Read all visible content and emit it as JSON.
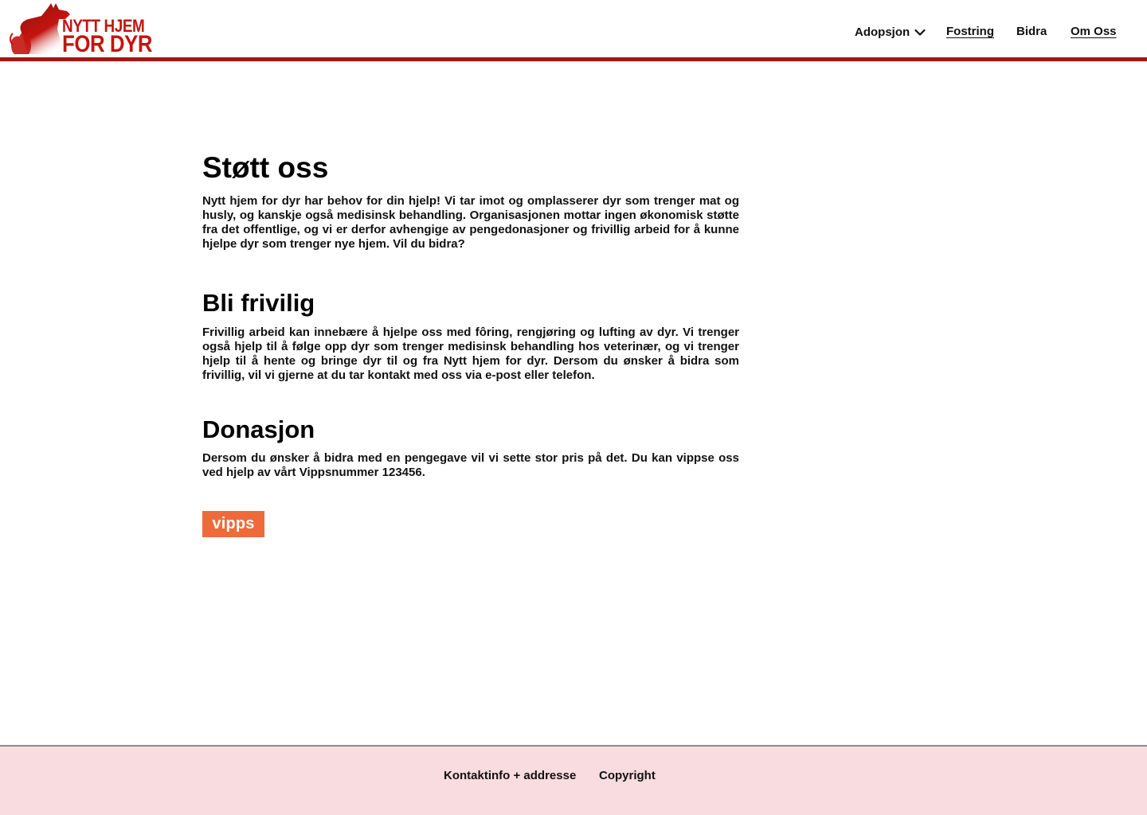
{
  "header": {
    "logo": {
      "line1": "NYTT HJEM",
      "line2": "FOR DYR",
      "icon": "dog-cat-silhouette-icon",
      "color": "#c4140f"
    },
    "nav": {
      "adopsjon": "Adopsjon",
      "fostring": "Fostring",
      "bidra": "Bidra",
      "om_oss": "Om Oss"
    },
    "rule_color": "#a31713"
  },
  "main": {
    "title": "Støtt oss",
    "intro": "Nytt hjem for dyr har behov for din hjelp! Vi tar imot og omplasserer dyr som trenger mat og husly, og kanskje også medisinsk behandling. Organisasjonen mottar ingen økonomisk støtte fra det offentlige, og vi er derfor avhengige av pengedonasjoner og frivillig arbeid for å kunne hjelpe dyr som trenger nye hjem. Vil du bidra?",
    "volunteer_heading": "Bli frivilig",
    "volunteer_text": "Frivillig arbeid kan innebære å hjelpe oss med fôring, rengjøring og lufting av dyr. Vi trenger også hjelp til å følge opp dyr som trenger medisinsk behandling hos veterinær, og vi trenger hjelp til å hente og bringe dyr til og fra Nytt hjem for dyr. Dersom du ønsker å bidra som frivillig, vil vi gjerne at du tar kontakt med oss via e-post eller telefon.",
    "donation_heading": "Donasjon",
    "donation_text": "Dersom du ønsker å bidra med en pengegave vil vi sette stor pris på det. Du kan vippse oss ved hjelp av vårt Vippsnummer 123456.",
    "vipps_label": "vipps",
    "vipps_color": "#ef6a3a"
  },
  "footer": {
    "contact": "Kontaktinfo + addresse",
    "copyright": "Copyright",
    "background": "#f8dcdf"
  }
}
